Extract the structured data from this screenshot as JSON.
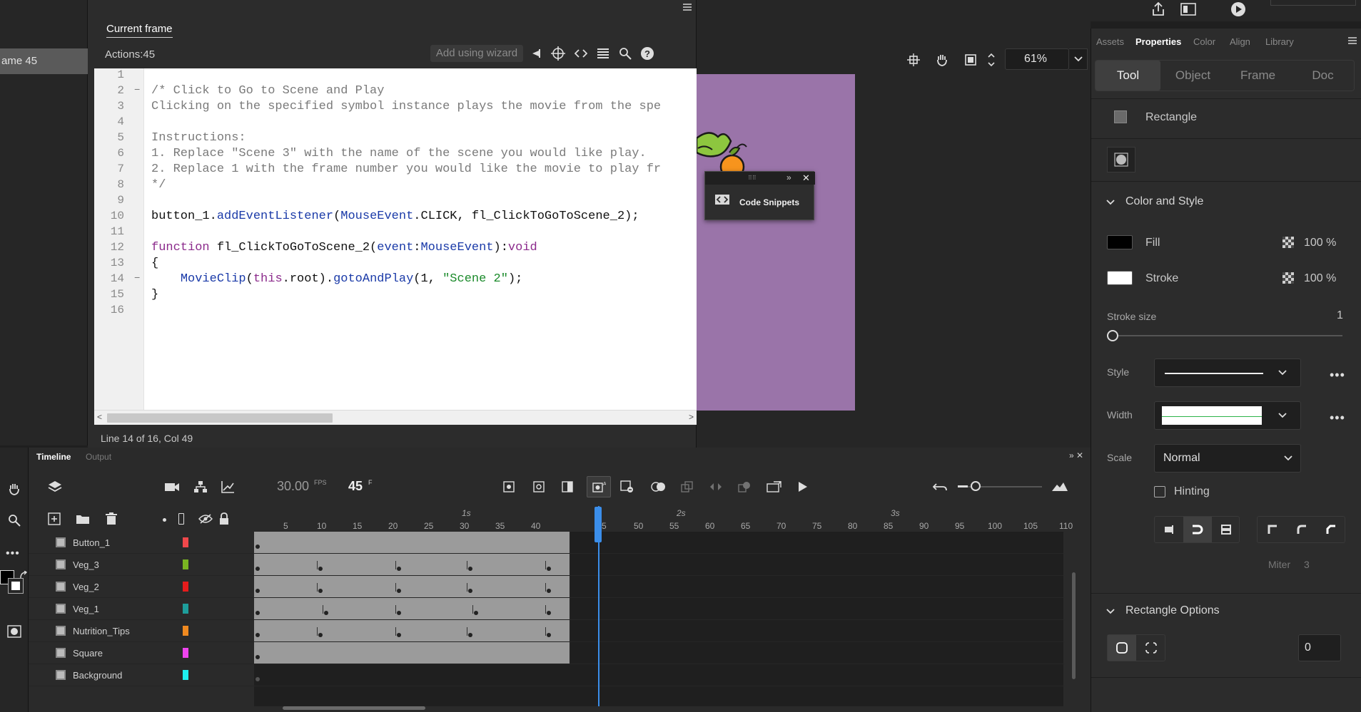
{
  "scene_strip": {
    "item_label": "ame 45"
  },
  "actions_panel": {
    "tab": "Current frame",
    "label": "Actions:45",
    "wizard_button": "Add using wizard",
    "status_line": "Line 14 of 16, Col 49"
  },
  "code": {
    "line_numbers": [
      "1",
      "2",
      "3",
      "4",
      "5",
      "6",
      "7",
      "8",
      "9",
      "10",
      "11",
      "12",
      "13",
      "14",
      "15",
      "16"
    ],
    "l2": "/* Click to Go to Scene and Play",
    "l3": "Clicking on the specified symbol instance plays the movie from the spe",
    "l5": "Instructions:",
    "l6": "1. Replace \"Scene 3\" with the name of the scene you would like play.",
    "l7": "2. Replace 1 with the frame number you would like the movie to play fr",
    "l8": "*/",
    "l10a": "button_1.",
    "l10b": "addEventListener",
    "l10c": "(",
    "l10d": "MouseEvent",
    "l10e": ".CLICK, fl_ClickToGoToScene_2);",
    "l12a": "function",
    "l12b": " fl_ClickToGoToScene_2(",
    "l12c": "event",
    "l12d": ":",
    "l12e": "MouseEvent",
    "l12f": "):",
    "l12g": "void",
    "l13": "{",
    "l14a": "    ",
    "l14b": "MovieClip",
    "l14c": "(",
    "l14d": "this",
    "l14e": ".root).",
    "l14f": "gotoAndPlay",
    "l14g": "(1, ",
    "l14h": "\"Scene 2\"",
    "l14i": ");",
    "l15": "}"
  },
  "stage": {
    "zoom": "61%",
    "floating_panel_label": "Code Snippets"
  },
  "properties": {
    "tabs": [
      "Assets",
      "Properties",
      "Color",
      "Align",
      "Library"
    ],
    "segments": [
      "Tool",
      "Object",
      "Frame",
      "Doc"
    ],
    "tool_name": "Rectangle",
    "color_style_title": "Color and Style",
    "fill_label": "Fill",
    "fill_alpha": "100 %",
    "stroke_label": "Stroke",
    "stroke_alpha": "100 %",
    "stroke_size_label": "Stroke size",
    "stroke_size_value": "1",
    "style_label": "Style",
    "width_label": "Width",
    "scale_label": "Scale",
    "scale_value": "Normal",
    "hinting_label": "Hinting",
    "miter_label": "Miter",
    "miter_value": "3",
    "rect_options_title": "Rectangle Options",
    "corner_value": "0",
    "colors": {
      "fill": "#000000",
      "stroke": "#ffffff",
      "accent": "#3b8eea"
    }
  },
  "timeline": {
    "tabs": [
      "Timeline",
      "Output"
    ],
    "fps": "30.00",
    "fps_unit": "FPS",
    "current_frame": "45",
    "frame_unit": "F",
    "seconds": [
      "1s",
      "2s",
      "3s"
    ],
    "ticks": [
      "5",
      "10",
      "15",
      "20",
      "25",
      "30",
      "35",
      "40",
      "5",
      "50",
      "55",
      "60",
      "65",
      "70",
      "75",
      "80",
      "85",
      "90",
      "95",
      "100",
      "105",
      "110"
    ],
    "layers": [
      {
        "name": "Button_1",
        "color": "#f0484b"
      },
      {
        "name": "Veg_3",
        "color": "#79b521"
      },
      {
        "name": "Veg_2",
        "color": "#e51c1c"
      },
      {
        "name": "Veg_1",
        "color": "#1e9e9b"
      },
      {
        "name": "Nutrition_Tips",
        "color": "#f08a20"
      },
      {
        "name": "Square",
        "color": "#ee44ee"
      },
      {
        "name": "Background",
        "color": "#1ef0f0"
      }
    ]
  }
}
